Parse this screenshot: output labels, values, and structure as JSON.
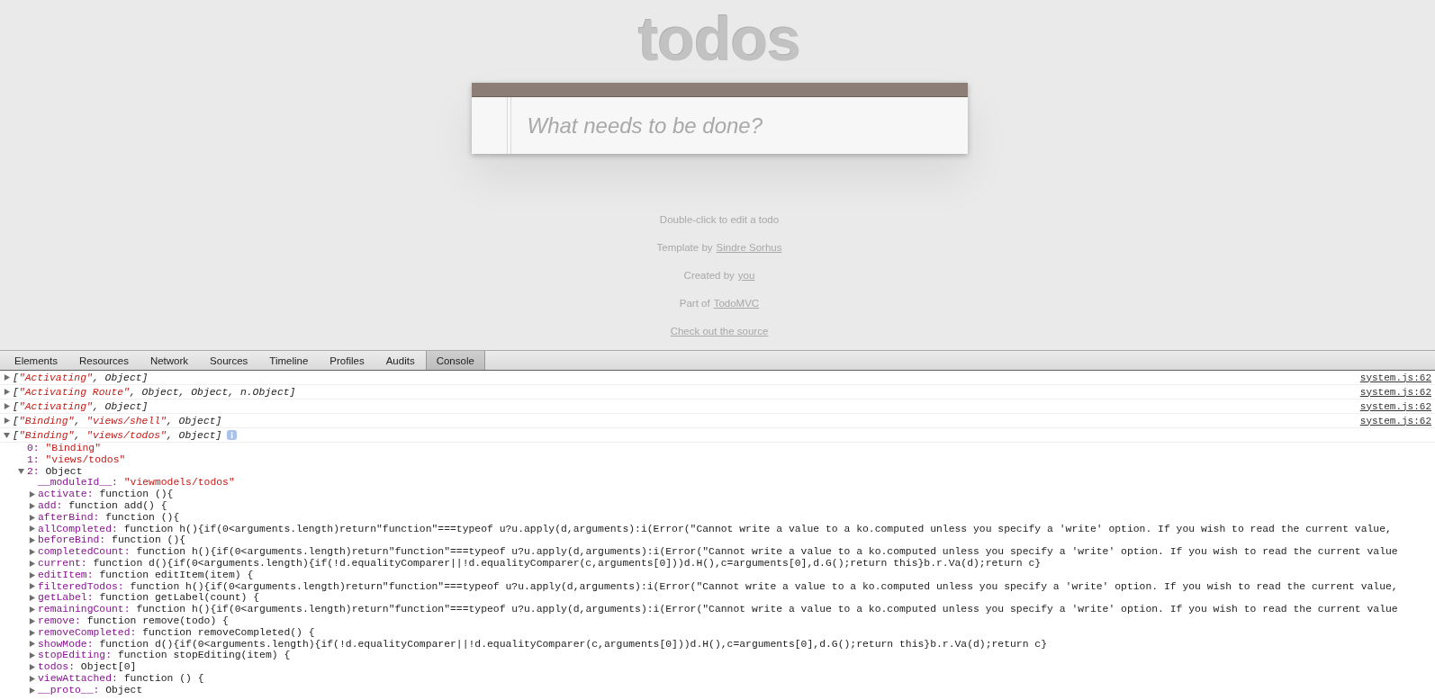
{
  "app": {
    "title": "todos",
    "new_todo": {
      "placeholder": "What needs to be done?"
    },
    "footer": [
      {
        "parts": [
          {
            "text": "Double-click to edit a todo",
            "link": false
          }
        ]
      },
      {
        "parts": [
          {
            "text": "Template by",
            "link": false
          },
          {
            "text": "Sindre Sorhus",
            "link": true
          }
        ]
      },
      {
        "parts": [
          {
            "text": "Created by",
            "link": false
          },
          {
            "text": "you",
            "link": true
          }
        ]
      },
      {
        "parts": [
          {
            "text": "Part of",
            "link": false
          },
          {
            "text": "TodoMVC",
            "link": true
          }
        ]
      },
      {
        "parts": [
          {
            "text": "Check out the source",
            "link": true
          }
        ]
      }
    ]
  },
  "devtools": {
    "tabs": [
      {
        "label": "Elements",
        "selected": false
      },
      {
        "label": "Resources",
        "selected": false
      },
      {
        "label": "Network",
        "selected": false
      },
      {
        "label": "Sources",
        "selected": false
      },
      {
        "label": "Timeline",
        "selected": false
      },
      {
        "label": "Profiles",
        "selected": false
      },
      {
        "label": "Audits",
        "selected": false
      },
      {
        "label": "Console",
        "selected": true
      }
    ],
    "console": {
      "messages": [
        {
          "expanded": false,
          "info": false,
          "source": "system.js:62",
          "tokens": [
            {
              "text": "[",
              "kind": "plain"
            },
            {
              "text": "\"Activating\"",
              "kind": "string"
            },
            {
              "text": ", Object]",
              "kind": "plain"
            }
          ]
        },
        {
          "expanded": false,
          "info": false,
          "source": "system.js:62",
          "tokens": [
            {
              "text": "[",
              "kind": "plain"
            },
            {
              "text": "\"Activating Route\"",
              "kind": "string"
            },
            {
              "text": ", Object, Object, n.Object]",
              "kind": "plain"
            }
          ]
        },
        {
          "expanded": false,
          "info": false,
          "source": "system.js:62",
          "tokens": [
            {
              "text": "[",
              "kind": "plain"
            },
            {
              "text": "\"Activating\"",
              "kind": "string"
            },
            {
              "text": ", Object]",
              "kind": "plain"
            }
          ]
        },
        {
          "expanded": false,
          "info": false,
          "source": "system.js:62",
          "tokens": [
            {
              "text": "[",
              "kind": "plain"
            },
            {
              "text": "\"Binding\"",
              "kind": "string"
            },
            {
              "text": ", ",
              "kind": "plain"
            },
            {
              "text": "\"views/shell\"",
              "kind": "string"
            },
            {
              "text": ", Object]",
              "kind": "plain"
            }
          ]
        },
        {
          "expanded": true,
          "info": true,
          "tokens": [
            {
              "text": "[",
              "kind": "plain"
            },
            {
              "text": "\"Binding\"",
              "kind": "string"
            },
            {
              "text": ", ",
              "kind": "plain"
            },
            {
              "text": "\"views/todos\"",
              "kind": "string"
            },
            {
              "text": ", Object]",
              "kind": "plain"
            }
          ],
          "children": [
            {
              "key": "0:",
              "value": "\"Binding\"",
              "kind": "string"
            },
            {
              "key": "1:",
              "value": "\"views/todos\"",
              "kind": "string"
            },
            {
              "key": "2:",
              "value": "Object",
              "kind": "plain",
              "expanded": true,
              "children": [
                {
                  "key": "__moduleId__:",
                  "value": "\"viewmodels/todos\"",
                  "kind": "string"
                },
                {
                  "key": "activate:",
                  "value": "function (){",
                  "kind": "plain",
                  "expanded": false
                },
                {
                  "key": "add:",
                  "value": "function add() {",
                  "kind": "plain",
                  "expanded": false
                },
                {
                  "key": "afterBind:",
                  "value": "function (){",
                  "kind": "plain",
                  "expanded": false
                },
                {
                  "key": "allCompleted:",
                  "value": "function h(){if(0<arguments.length)return\"function\"===typeof u?u.apply(d,arguments):i(Error(\"Cannot write a value to a ko.computed unless you specify a 'write' option. If you wish to read the current value,",
                  "kind": "plain",
                  "expanded": false
                },
                {
                  "key": "beforeBind:",
                  "value": "function (){",
                  "kind": "plain",
                  "expanded": false
                },
                {
                  "key": "completedCount:",
                  "value": "function h(){if(0<arguments.length)return\"function\"===typeof u?u.apply(d,arguments):i(Error(\"Cannot write a value to a ko.computed unless you specify a 'write' option. If you wish to read the current value",
                  "kind": "plain",
                  "expanded": false
                },
                {
                  "key": "current:",
                  "value": "function d(){if(0<arguments.length){if(!d.equalityComparer||!d.equalityComparer(c,arguments[0]))d.H(),c=arguments[0],d.G();return this}b.r.Va(d);return c}",
                  "kind": "plain",
                  "expanded": false
                },
                {
                  "key": "editItem:",
                  "value": "function editItem(item) {",
                  "kind": "plain",
                  "expanded": false
                },
                {
                  "key": "filteredTodos:",
                  "value": "function h(){if(0<arguments.length)return\"function\"===typeof u?u.apply(d,arguments):i(Error(\"Cannot write a value to a ko.computed unless you specify a 'write' option. If you wish to read the current value,",
                  "kind": "plain",
                  "expanded": false
                },
                {
                  "key": "getLabel:",
                  "value": "function getLabel(count) {",
                  "kind": "plain",
                  "expanded": false
                },
                {
                  "key": "remainingCount:",
                  "value": "function h(){if(0<arguments.length)return\"function\"===typeof u?u.apply(d,arguments):i(Error(\"Cannot write a value to a ko.computed unless you specify a 'write' option. If you wish to read the current value",
                  "kind": "plain",
                  "expanded": false
                },
                {
                  "key": "remove:",
                  "value": "function remove(todo) {",
                  "kind": "plain",
                  "expanded": false
                },
                {
                  "key": "removeCompleted:",
                  "value": "function removeCompleted() {",
                  "kind": "plain",
                  "expanded": false
                },
                {
                  "key": "showMode:",
                  "value": "function d(){if(0<arguments.length){if(!d.equalityComparer||!d.equalityComparer(c,arguments[0]))d.H(),c=arguments[0],d.G();return this}b.r.Va(d);return c}",
                  "kind": "plain",
                  "expanded": false
                },
                {
                  "key": "stopEditing:",
                  "value": "function stopEditing(item) {",
                  "kind": "plain",
                  "expanded": false
                },
                {
                  "key": "todos:",
                  "value": "Object[0]",
                  "kind": "plain",
                  "expanded": false
                },
                {
                  "key": "viewAttached:",
                  "value": "function () {",
                  "kind": "plain",
                  "expanded": false
                },
                {
                  "key": "__proto__:",
                  "value": "Object",
                  "kind": "plain",
                  "expanded": false
                }
              ]
            }
          ]
        }
      ]
    }
  }
}
